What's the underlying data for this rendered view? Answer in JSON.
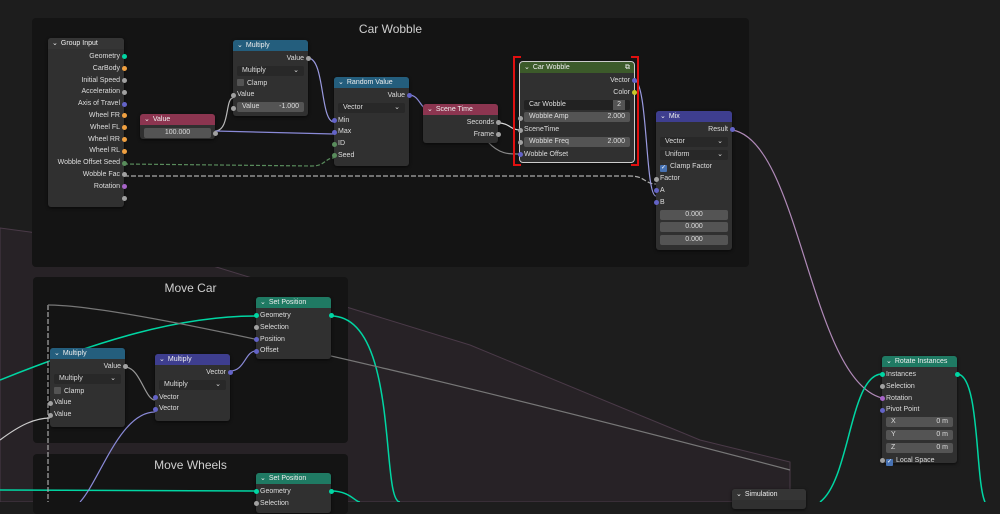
{
  "frames": {
    "car_wobble": "Car Wobble",
    "move_car": "Move Car",
    "move_wheels": "Move Wheels"
  },
  "colors": {
    "geometry": "#00d6a3",
    "object": "#f0a040",
    "float": "#a1a1a1",
    "vector": "#6363c7",
    "int": "#598c5c",
    "rotation": "#a663c7",
    "color": "#c7c729",
    "hdr_input": "#8c3550",
    "hdr_math": "#245e7d",
    "hdr_vector": "#3e3e8f",
    "hdr_geo": "#1f7a63",
    "hdr_group": "#3c5a2a",
    "hdr_sim": "#353535"
  },
  "nodes": {
    "group_input": {
      "title": "Group Input",
      "hc": "hdr_sim",
      "rows": [
        {
          "t": "out",
          "l": "Geometry",
          "s": "geometry"
        },
        {
          "t": "out",
          "l": "CarBody",
          "s": "object"
        },
        {
          "t": "out",
          "l": "Initial Speed",
          "s": "float"
        },
        {
          "t": "out",
          "l": "Acceleration",
          "s": "float"
        },
        {
          "t": "out",
          "l": "Axis of Travel",
          "s": "vector"
        },
        {
          "t": "out",
          "l": "Wheel FR",
          "s": "object"
        },
        {
          "t": "out",
          "l": "Wheel FL",
          "s": "object"
        },
        {
          "t": "out",
          "l": "Wheel RR",
          "s": "object"
        },
        {
          "t": "out",
          "l": "Wheel RL",
          "s": "object"
        },
        {
          "t": "out",
          "l": "Wobble Offset Seed",
          "s": "int"
        },
        {
          "t": "out",
          "l": "Wobble Fac",
          "s": "float"
        },
        {
          "t": "out",
          "l": "Rotation",
          "s": "rotation"
        },
        {
          "t": "out",
          "l": "",
          "s": "float"
        }
      ]
    },
    "value": {
      "title": "Value",
      "hc": "hdr_input",
      "rows": [
        {
          "t": "fldc",
          "v": "100.000",
          "so": "float"
        }
      ]
    },
    "multiply_top": {
      "title": "Multiply",
      "hc": "hdr_math",
      "rows": [
        {
          "t": "out",
          "l": "Value",
          "s": "float"
        },
        {
          "t": "dd",
          "l": "Multiply"
        },
        {
          "t": "cb",
          "l": "Clamp",
          "on": false
        },
        {
          "t": "in",
          "l": "Value",
          "s": "float"
        },
        {
          "t": "fld",
          "l": "Value",
          "v": "-1.000",
          "si": "float"
        }
      ]
    },
    "random_value": {
      "title": "Random Value",
      "hc": "hdr_math",
      "rows": [
        {
          "t": "out",
          "l": "Value",
          "s": "vector"
        },
        {
          "t": "dd",
          "l": "Vector"
        },
        {
          "t": "in",
          "l": "Min",
          "s": "vector"
        },
        {
          "t": "in",
          "l": "Max",
          "s": "vector"
        },
        {
          "t": "in",
          "l": "ID",
          "s": "int"
        },
        {
          "t": "in",
          "l": "Seed",
          "s": "int"
        }
      ]
    },
    "scene_time": {
      "title": "Scene Time",
      "hc": "hdr_input",
      "rows": [
        {
          "t": "out",
          "l": "Seconds",
          "s": "float"
        },
        {
          "t": "out",
          "l": "Frame",
          "s": "float"
        }
      ]
    },
    "car_wobble": {
      "title": "Car Wobble",
      "hc": "hdr_group",
      "rows": [
        {
          "t": "out",
          "l": "Vector",
          "s": "vector"
        },
        {
          "t": "out",
          "l": "Color",
          "s": "color"
        },
        {
          "t": "grp",
          "l": "Car Wobble",
          "v": "2"
        },
        {
          "t": "fld",
          "l": "Wobble Amp",
          "v": "2.000",
          "si": "float"
        },
        {
          "t": "in",
          "l": "SceneTime",
          "s": "float"
        },
        {
          "t": "fld",
          "l": "Wobble Freq",
          "v": "2.000",
          "si": "float"
        },
        {
          "t": "in",
          "l": "Wobble Offset",
          "s": "vector"
        }
      ]
    },
    "mix": {
      "title": "Mix",
      "hc": "hdr_vector",
      "rows": [
        {
          "t": "out",
          "l": "Result",
          "s": "vector"
        },
        {
          "t": "dd",
          "l": "Vector"
        },
        {
          "t": "dd",
          "l": "Uniform"
        },
        {
          "t": "cb",
          "l": "Clamp Factor",
          "on": true
        },
        {
          "t": "in",
          "l": "Factor",
          "s": "float"
        },
        {
          "t": "in",
          "l": "A",
          "s": "vector"
        },
        {
          "t": "in",
          "l": "B",
          "s": "vector"
        },
        {
          "t": "fldc",
          "v": "0.000"
        },
        {
          "t": "fldc",
          "v": "0.000"
        },
        {
          "t": "fldc",
          "v": "0.000"
        }
      ]
    },
    "set_position_car": {
      "title": "Set Position",
      "hc": "hdr_geo",
      "rows": [
        {
          "t": "both",
          "l": "Geometry",
          "s": "geometry"
        },
        {
          "t": "in",
          "l": "Selection",
          "s": "float"
        },
        {
          "t": "in",
          "l": "Position",
          "s": "vector"
        },
        {
          "t": "in",
          "l": "Offset",
          "s": "vector"
        }
      ]
    },
    "multiply_left": {
      "title": "Multiply",
      "hc": "hdr_math",
      "rows": [
        {
          "t": "out",
          "l": "Value",
          "s": "float"
        },
        {
          "t": "dd",
          "l": "Multiply"
        },
        {
          "t": "cb",
          "l": "Clamp",
          "on": false
        },
        {
          "t": "in",
          "l": "Value",
          "s": "float"
        },
        {
          "t": "in",
          "l": "Value",
          "s": "float"
        }
      ]
    },
    "multiply_vector": {
      "title": "Multiply",
      "hc": "hdr_vector",
      "rows": [
        {
          "t": "out",
          "l": "Vector",
          "s": "vector"
        },
        {
          "t": "dd",
          "l": "Multiply"
        },
        {
          "t": "in",
          "l": "Vector",
          "s": "vector"
        },
        {
          "t": "in",
          "l": "Vector",
          "s": "vector"
        }
      ]
    },
    "set_position_wheels": {
      "title": "Set Position",
      "hc": "hdr_geo",
      "rows": [
        {
          "t": "both",
          "l": "Geometry",
          "s": "geometry"
        },
        {
          "t": "in",
          "l": "Selection",
          "s": "float"
        }
      ]
    },
    "rotate_instances": {
      "title": "Rotate Instances",
      "hc": "hdr_geo",
      "rows": [
        {
          "t": "both",
          "l": "Instances",
          "s": "geometry"
        },
        {
          "t": "in",
          "l": "Selection",
          "s": "float"
        },
        {
          "t": "in",
          "l": "Rotation",
          "s": "rotation"
        },
        {
          "t": "in",
          "l": "Pivot Point",
          "s": "vector"
        },
        {
          "t": "fld",
          "l": "X",
          "v": "0 m"
        },
        {
          "t": "fld",
          "l": "Y",
          "v": "0 m"
        },
        {
          "t": "fld",
          "l": "Z",
          "v": "0 m"
        },
        {
          "t": "cb",
          "l": "Local Space",
          "on": true,
          "si": "float"
        }
      ]
    },
    "simulation": {
      "title": "Simulation",
      "hc": "hdr_sim",
      "rows": []
    }
  }
}
